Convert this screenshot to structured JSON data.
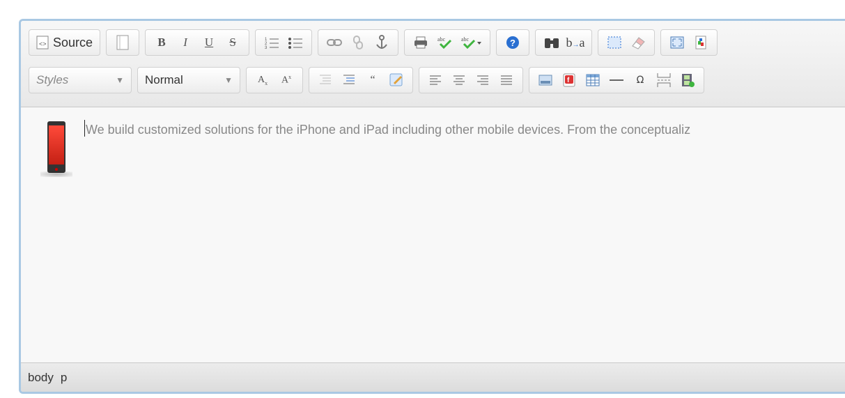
{
  "toolbar": {
    "source_label": "Source",
    "styles_label": "Styles",
    "format_label": "Normal",
    "colors": {
      "link_gray": "#9aa0a6",
      "green_check": "#3fb53f",
      "help_blue": "#2a6fd1"
    }
  },
  "content": {
    "text": "We build customized solutions for the iPhone and iPad including other mobile devices. From the conceptualiz"
  },
  "statusbar": {
    "path": [
      "body",
      "p"
    ]
  }
}
